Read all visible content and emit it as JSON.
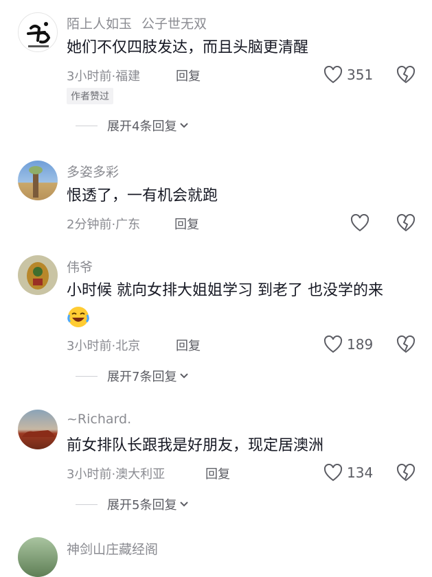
{
  "comments": [
    {
      "username": "陌上人如玉",
      "username_suffix": "公子世无双",
      "text": "她们不仅四肢发达，而且头脑更清醒",
      "meta": "3小时前·福建",
      "reply_label": "回复",
      "likes": "351",
      "badge": "作者赞过",
      "expand_label": "展开4条回复"
    },
    {
      "username": "多姿多彩",
      "text": "恨透了，一有机会就跑",
      "meta": "2分钟前·广东",
      "reply_label": "回复",
      "likes": ""
    },
    {
      "username": "伟爷",
      "text": "小时候 就向女排大姐姐学习 到老了 也没学的来",
      "meta": "3小时前·北京",
      "reply_label": "回复",
      "likes": "189",
      "expand_label": "展开7条回复"
    },
    {
      "username": "~Richard.",
      "text": "前女排队长跟我是好朋友，现定居澳洲",
      "meta": "3小时前·澳大利亚",
      "reply_label": "回复",
      "likes": "134",
      "expand_label": "展开5条回复"
    },
    {
      "username": "神剑山庄藏经阁"
    }
  ]
}
